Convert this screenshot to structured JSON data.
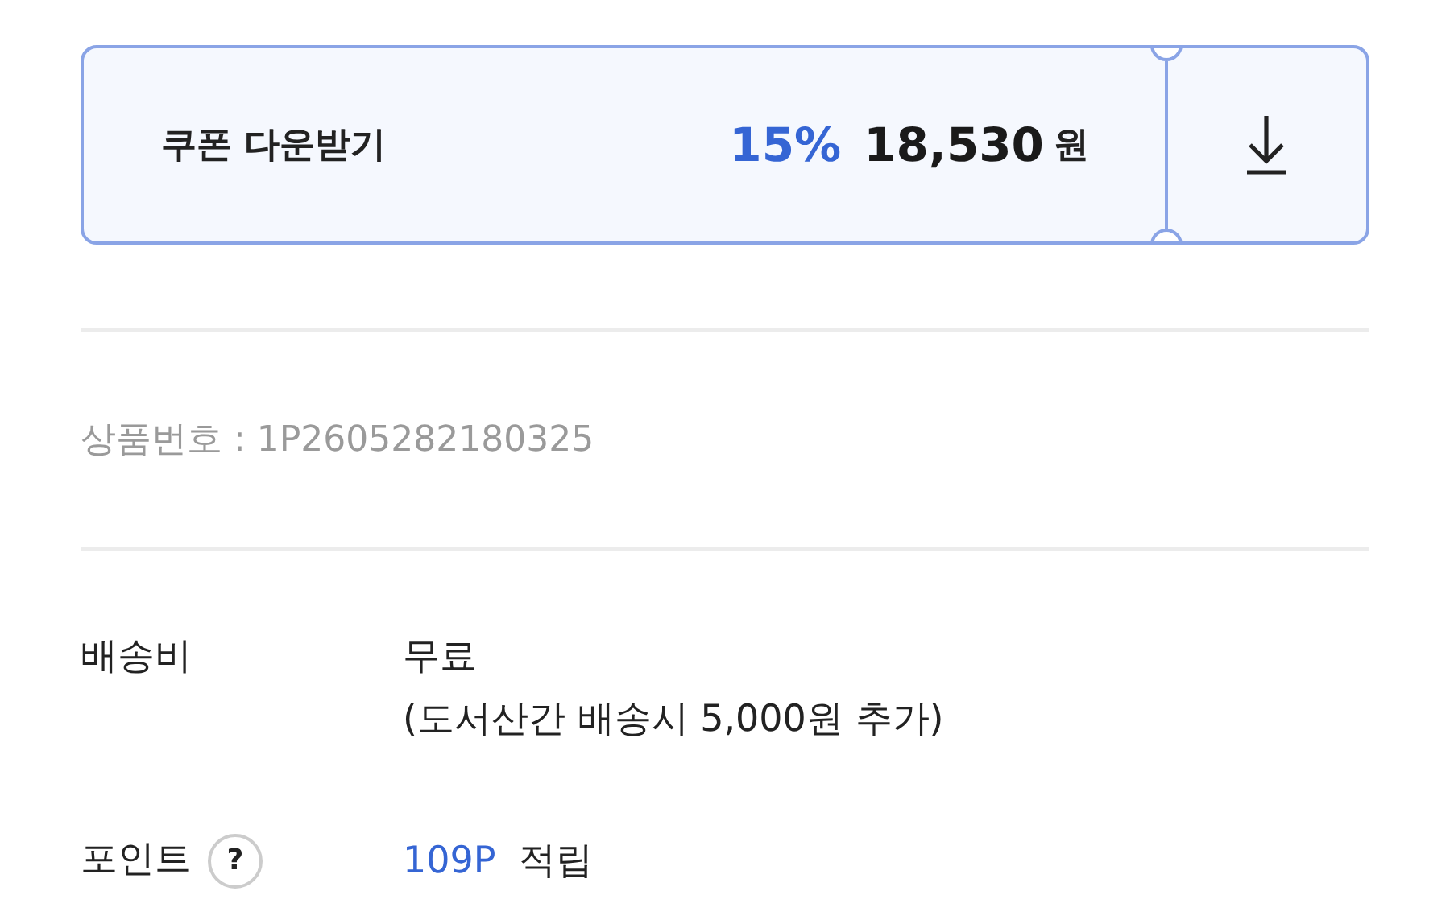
{
  "coupon": {
    "label": "쿠폰 다운받기",
    "discount": "15%",
    "price": "18,530",
    "currency": "원"
  },
  "product_number": "상품번호 : 1P2605282180325",
  "shipping": {
    "label": "배송비",
    "value": "무료",
    "note": "(도서산간 배송시 5,000원 추가)"
  },
  "points": {
    "label": "포인트",
    "help": "?",
    "amount": "109P",
    "suffix": "적립"
  }
}
